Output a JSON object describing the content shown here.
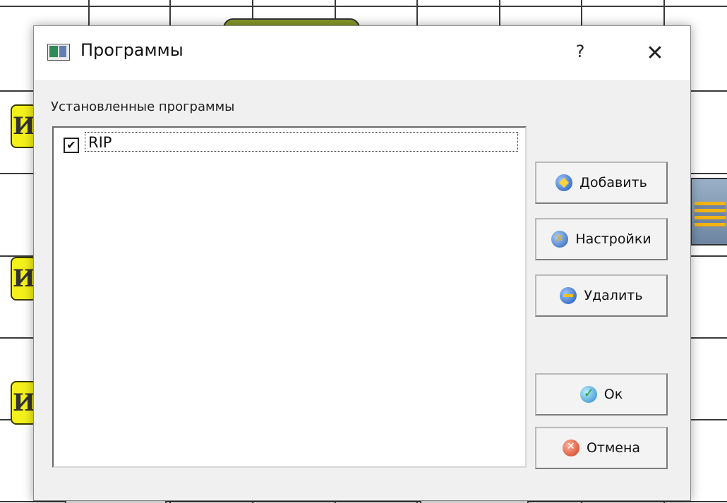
{
  "dialog": {
    "title": "Программы",
    "help_label": "?",
    "close_label": "✕"
  },
  "programs": {
    "group_label": "Установленные программы",
    "items": [
      {
        "label": "RIP",
        "checked": true
      }
    ]
  },
  "buttons": {
    "add": "Добавить",
    "settings": "Настройки",
    "remove": "Удалить",
    "ok": "Ок",
    "cancel": "Отмена"
  },
  "background": {
    "node_letter": "И"
  },
  "icons": {
    "add": "add-circle-icon",
    "settings": "settings-tools-icon",
    "remove": "remove-circle-icon",
    "ok": "ok-check-icon",
    "cancel": "cancel-x-icon"
  },
  "colors": {
    "node_fill": "#f4f11a",
    "dialog_bg": "#f0f0f0",
    "list_bg": "#ffffff"
  }
}
